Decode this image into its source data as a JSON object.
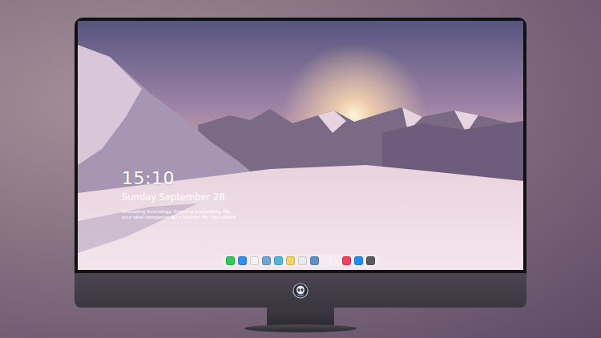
{
  "lock_screen": {
    "time": "15:10",
    "date": "Sunday September 28",
    "tagline": [
      "Innovating technology, Ensuring productivity. Mo",
      "your ideal companion for a smarter life. Specialized"
    ]
  },
  "dock": {
    "apps": [
      {
        "color": "#34c759"
      },
      {
        "color": "#2f8ef4"
      },
      {
        "color": "#f4f4f4"
      },
      {
        "color": "#6aa6d6"
      },
      {
        "color": "#4fb6e0"
      },
      {
        "color": "#f6d365"
      },
      {
        "color": "#ececec"
      },
      {
        "color": "#5b8fd0"
      }
    ],
    "recent": [
      {
        "color": "#fa3f5e"
      },
      {
        "color": "#1c8ef9"
      },
      {
        "color": "#5a5a5a"
      }
    ]
  }
}
